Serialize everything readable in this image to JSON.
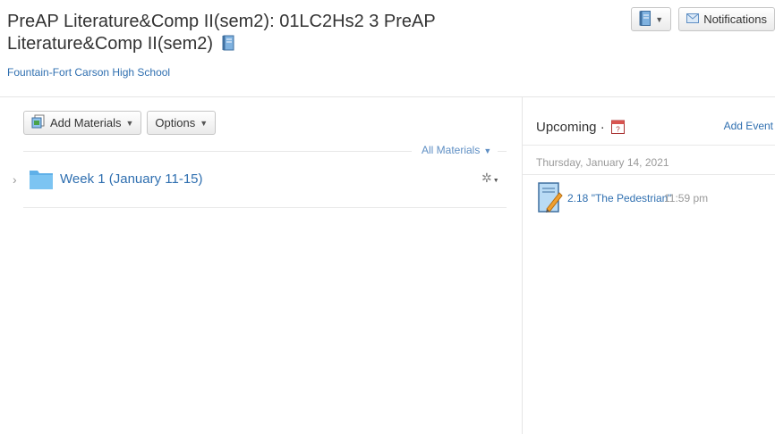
{
  "header": {
    "title": "PreAP Literature&Comp II(sem2): 01LC2Hs2 3 PreAP Literature&Comp II(sem2)",
    "school": "Fountain-Fort Carson High School",
    "notifications_label": "Notifications"
  },
  "toolbar": {
    "add_materials_label": "Add Materials",
    "options_label": "Options",
    "filter_label": "All Materials"
  },
  "materials": {
    "items": [
      {
        "title": "Week 1 (January 11-15)"
      }
    ]
  },
  "upcoming": {
    "title": "Upcoming ·",
    "add_event_label": "Add Event",
    "date": "Thursday, January 14, 2021",
    "events": [
      {
        "title": "2.18 \"The Pedestrian\"",
        "time": "11:59 pm"
      }
    ]
  },
  "icons": {
    "notebook": "notebook-icon",
    "envelope": "envelope-icon",
    "folder": "folder-icon",
    "gear": "gear-icon",
    "calendar": "calendar-icon",
    "assignment": "assignment-icon"
  },
  "colors": {
    "link": "#2f6fb0",
    "folder": "#5fb0e8",
    "muted": "#9a9a9a"
  }
}
